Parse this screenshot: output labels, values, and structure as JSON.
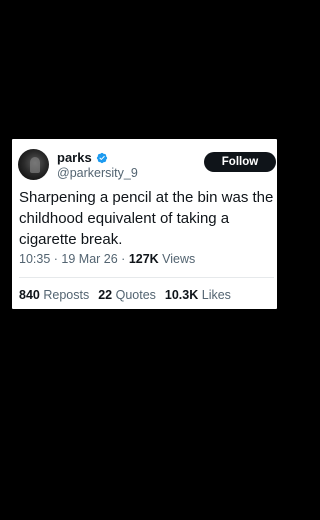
{
  "author": {
    "display_name": "parks",
    "handle": "@parkersity_9",
    "verified_color": "#1d9bf0",
    "avatar_icon": "avatar"
  },
  "follow_label": "Follow",
  "tweet": {
    "text": "Sharpening a pencil at the bin was the childhood equivalent of taking a cigarette break.",
    "time": "10:35",
    "date": "19 Mar 26",
    "views_count": "127K",
    "views_label": "Views"
  },
  "stats": {
    "reposts_count": "840",
    "reposts_label": "Reposts",
    "quotes_count": "22",
    "quotes_label": "Quotes",
    "likes_count": "10.3K",
    "likes_label": "Likes"
  },
  "colors": {
    "background": "#000000",
    "card": "#ffffff",
    "text_primary": "#0f1419",
    "text_secondary": "#536471",
    "verified": "#1d9bf0"
  }
}
